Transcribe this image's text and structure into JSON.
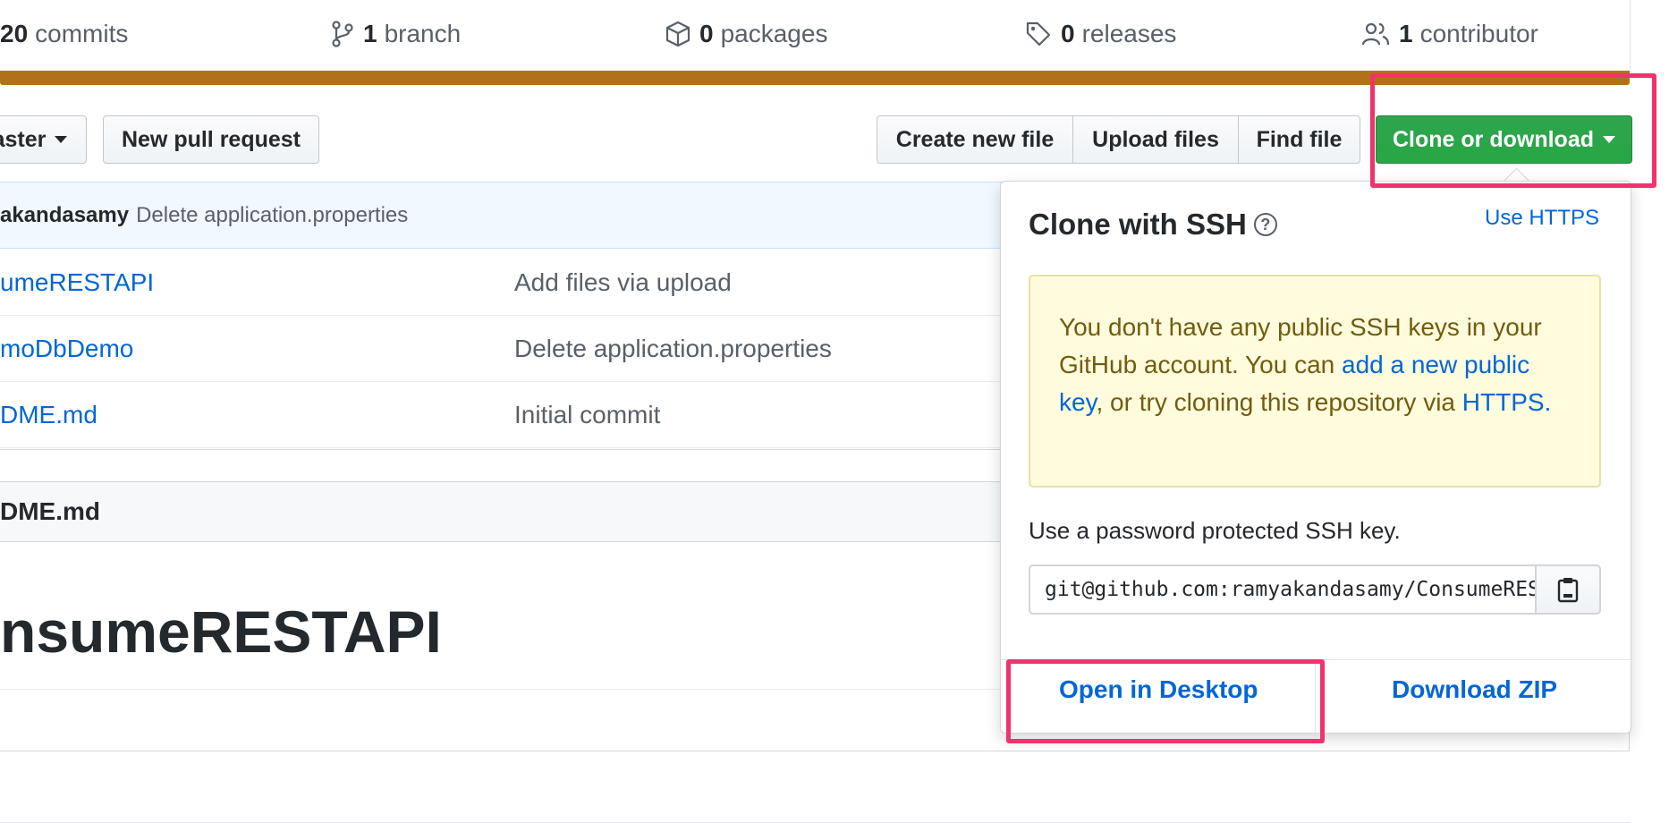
{
  "stats": {
    "commits": {
      "count": "20",
      "label": "commits",
      "icon": "history-icon"
    },
    "branch": {
      "count": "1",
      "label": "branch",
      "icon": "git-branch-icon"
    },
    "packages": {
      "count": "0",
      "label": "packages",
      "icon": "package-icon"
    },
    "releases": {
      "count": "0",
      "label": "releases",
      "icon": "tag-icon"
    },
    "contributor": {
      "count": "1",
      "label": "contributor",
      "icon": "people-icon"
    }
  },
  "language_bar_color": "#b07219",
  "toolbar": {
    "branch_label": "aster",
    "new_pull_request": "New pull request",
    "create_new_file": "Create new file",
    "upload_files": "Upload files",
    "find_file": "Find file",
    "clone_or_download": "Clone or download"
  },
  "latest_commit": {
    "author": "akandasamy",
    "message": "Delete application.properties"
  },
  "files": [
    {
      "name": "umeRESTAPI",
      "commit_message": "Add files via upload"
    },
    {
      "name": "moDbDemo",
      "commit_message": "Delete application.properties"
    },
    {
      "name": "DME.md",
      "commit_message": "Initial commit"
    }
  ],
  "readme": {
    "header": "DME.md",
    "title": "nsumeRESTAPI"
  },
  "clone_dropdown": {
    "title": "Clone with SSH",
    "use_https": "Use HTTPS",
    "flash_text_1": "You don't have any public SSH keys in your GitHub account. You can ",
    "flash_link_1": "add a new public key",
    "flash_text_2": ", or try cloning this repository via ",
    "flash_link_2": "HTTPS.",
    "ssh_note": "Use a password protected SSH key.",
    "clone_url": "git@github.com:ramyakandasamy/ConsumeRESTAPI.git",
    "open_in_desktop": "Open in Desktop",
    "download_zip": "Download ZIP"
  },
  "colors": {
    "accent_link": "#0366d6",
    "primary_button": "#28a745",
    "highlight": "#f0336d"
  }
}
